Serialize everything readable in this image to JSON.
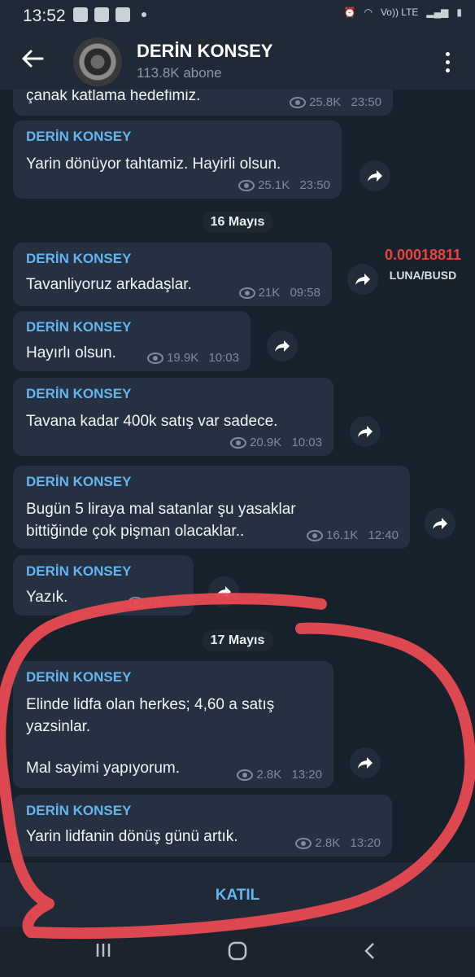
{
  "status_bar": {
    "time": "13:52",
    "network": "Vo)) LTE"
  },
  "header": {
    "title": "DERİN KONSEY",
    "subscribers": "113.8K abone"
  },
  "chat": {
    "messages": [
      {
        "sender": "",
        "text": "çanak katlama hedefimiz.",
        "views": "25.8K",
        "time": "23:50"
      },
      {
        "sender": "DERİN KONSEY",
        "text": "Yarin dönüyor tahtamiz. Hayirli olsun.",
        "views": "25.1K",
        "time": "23:50"
      },
      {
        "sender": "DERİN KONSEY",
        "text": "Tavanliyoruz arkadaşlar.",
        "views": "21K",
        "time": "09:58"
      },
      {
        "sender": "DERİN KONSEY",
        "text": "Hayırlı olsun.",
        "views": "19.9K",
        "time": "10:03"
      },
      {
        "sender": "DERİN KONSEY",
        "text": "Tavana kadar 400k satış var sadece.",
        "views": "20.9K",
        "time": "10:03"
      },
      {
        "sender": "DERİN KONSEY",
        "text_line1": "Bugün 5 liraya mal satanlar şu yasaklar",
        "text_line2": "bittiğinde çok pişman olacaklar..",
        "views": "16.1K",
        "time": "12:40"
      },
      {
        "sender": "DERİN KONSEY",
        "text": "Yazık.",
        "views": "15",
        "time": ""
      },
      {
        "sender": "DERİN KONSEY",
        "text_line1": "Elinde lidfa olan herkes; 4,60 a satış",
        "text_line2": "yazsinlar.",
        "text_line3": "Mal sayimi yapıyorum.",
        "views": "2.8K",
        "time": "13:20"
      },
      {
        "sender": "DERİN KONSEY",
        "text": "Yarin lidfanin dönüş günü artık.",
        "views": "2.8K",
        "time": "13:20"
      }
    ],
    "dates": [
      "16 Mayıs",
      "17 Mayıs"
    ]
  },
  "ticker": {
    "value": "0.00018811",
    "pair": "LUNA/BUSD"
  },
  "join_button": "KATIL",
  "colors": {
    "accent": "#64b5ef",
    "bubble": "#253140",
    "background": "#17212b",
    "annotation": "#e84a52"
  }
}
